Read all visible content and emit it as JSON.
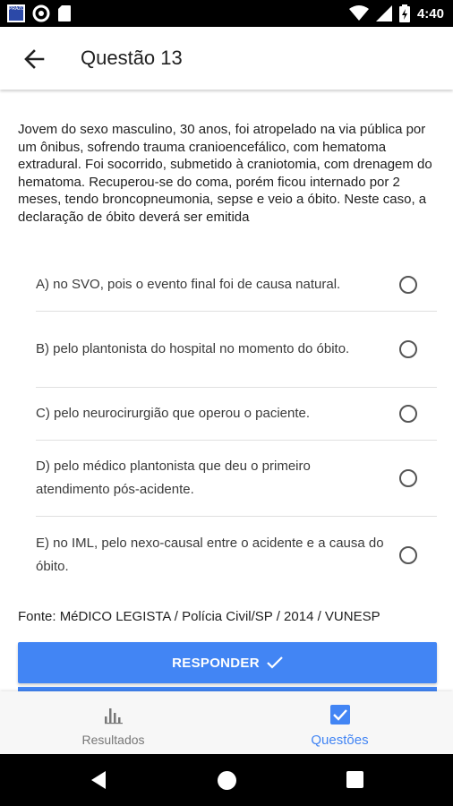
{
  "status_bar": {
    "time": "4:40",
    "app_icon_text": "PRAZO",
    "icons": [
      "app-icon",
      "circle-icon",
      "sim-card-icon",
      "wifi-icon",
      "signal-icon",
      "battery-icon"
    ]
  },
  "app_bar": {
    "title": "Questão 13",
    "back_icon": "arrow-left-icon"
  },
  "question": {
    "text": "Jovem do sexo masculino, 30 anos, foi atropelado na via pública por um ônibus, sofrendo trauma cranioencefálico, com hematoma extradural. Foi socorrido, submetido à craniotomia, com drenagem do hematoma. Recuperou-se do coma, porém ficou internado por 2 meses, tendo broncopneumonia, sepse e veio a óbito. Neste caso, a declaração de óbito deverá ser emitida"
  },
  "options": [
    {
      "label": "A) no SVO, pois o evento final foi de causa natural."
    },
    {
      "label": "B) pelo plantonista do hospital no momento do óbito."
    },
    {
      "label": "C) pelo neurocirurgião que operou o paciente."
    },
    {
      "label": "D) pelo médico plantonista que deu o primeiro atendimento pós-acidente."
    },
    {
      "label": "E) no IML, pelo nexo-causal entre o acidente e a causa do óbito."
    }
  ],
  "source": "Fonte: MéDICO LEGISTA / Polícia Civil/SP / 2014 / VUNESP",
  "respond_button": {
    "label": "RESPONDER",
    "icon": "check-icon"
  },
  "bottom_nav": {
    "items": [
      {
        "label": "Resultados",
        "icon": "bar-chart-icon",
        "active": false
      },
      {
        "label": "Questões",
        "icon": "checkbox-checked-icon",
        "active": true
      }
    ]
  },
  "colors": {
    "accent": "#4285f4",
    "text": "#212121",
    "divider": "#e0e0e0"
  }
}
